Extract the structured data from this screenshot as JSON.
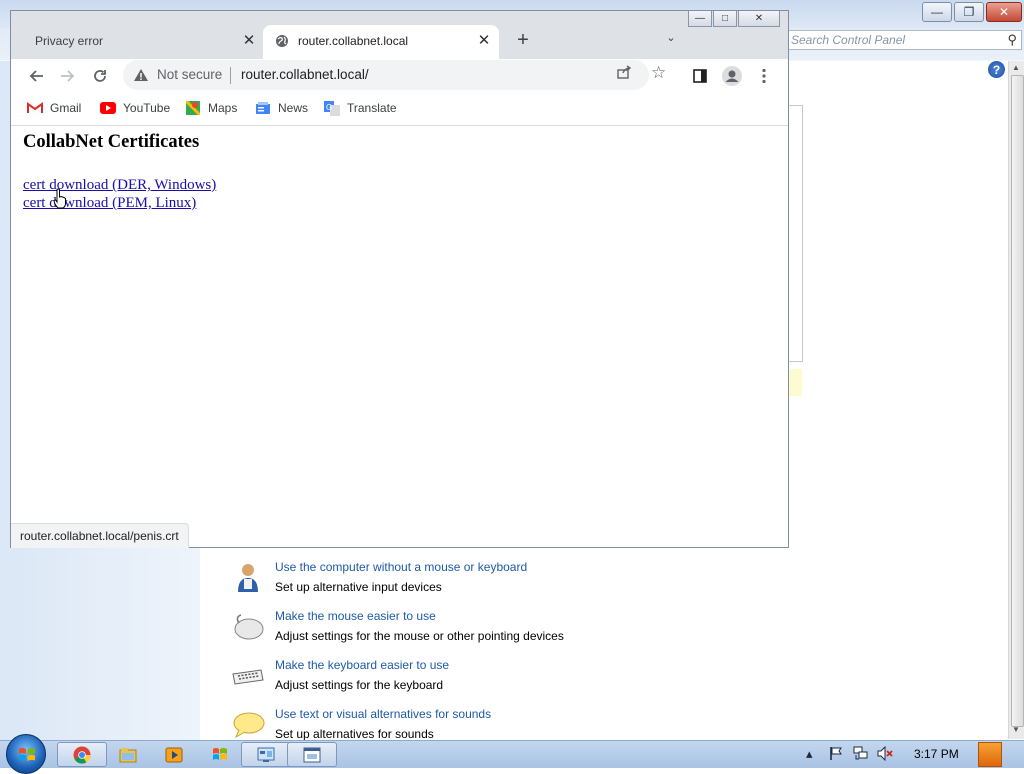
{
  "control_panel": {
    "search_placeholder": "Search Control Panel",
    "help_symbol": "?",
    "items": [
      {
        "link": "Use the computer without a mouse or keyboard",
        "desc": "Set up alternative input devices",
        "icon": "person-icon"
      },
      {
        "link": "Make the mouse easier to use",
        "desc": "Adjust settings for the mouse or other pointing devices",
        "icon": "mouse-icon"
      },
      {
        "link": "Make the keyboard easier to use",
        "desc": "Adjust settings for the keyboard",
        "icon": "keyboard-icon"
      },
      {
        "link": "Use text or visual alternatives for sounds",
        "desc": "Set up alternatives for sounds",
        "icon": "speech-bubble-icon"
      }
    ]
  },
  "browser": {
    "tabs": [
      {
        "label": "Privacy error",
        "active": false
      },
      {
        "label": "router.collabnet.local",
        "active": true
      }
    ],
    "omnibox": {
      "security_label": "Not secure",
      "url": "router.collabnet.local/"
    },
    "bookmarks": [
      {
        "label": "Gmail",
        "icon": "gmail-icon"
      },
      {
        "label": "YouTube",
        "icon": "youtube-icon"
      },
      {
        "label": "Maps",
        "icon": "maps-icon"
      },
      {
        "label": "News",
        "icon": "news-icon"
      },
      {
        "label": "Translate",
        "icon": "translate-icon"
      }
    ],
    "page": {
      "heading": "CollabNet Certificates",
      "links": [
        "cert download (DER, Windows)",
        "cert download (PEM, Linux)"
      ]
    },
    "status_url": "router.collabnet.local/penis.crt"
  },
  "taskbar": {
    "clock": "3:17 PM",
    "apps": [
      "chrome-icon",
      "file-explorer-icon",
      "media-player-icon",
      "paint-icon",
      "control-panel-icon",
      "window-icon"
    ]
  }
}
